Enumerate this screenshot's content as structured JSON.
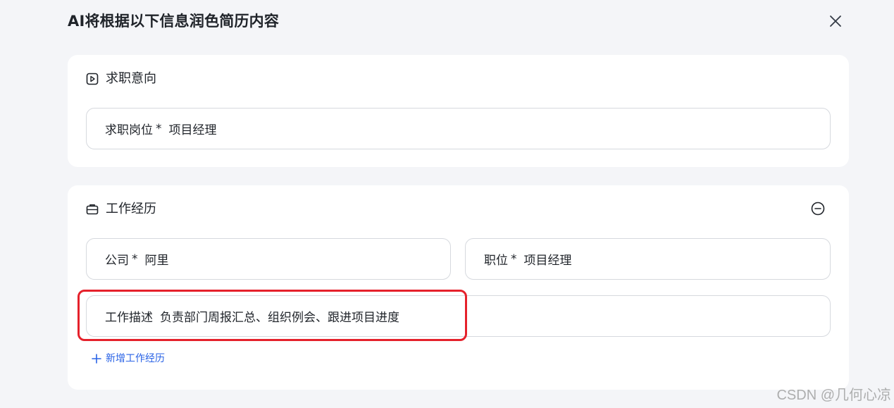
{
  "dialog": {
    "title": "AI将根据以下信息润色简历内容",
    "close_icon": "close-icon"
  },
  "job_intent": {
    "title": "求职意向",
    "icon": "flag-doc-icon",
    "position_label": "求职岗位",
    "required_mark": "*",
    "position_value": "项目经理"
  },
  "work_experience": {
    "title": "工作经历",
    "icon": "briefcase-icon",
    "collapse_icon": "minus-circle-icon",
    "company_label": "公司",
    "company_required": "*",
    "company_value": "阿里",
    "role_label": "职位",
    "role_required": "*",
    "role_value": "项目经理",
    "desc_label": "工作描述",
    "desc_value": "负责部门周报汇总、组织例会、跟进项目进度",
    "add_label": "新增工作经历",
    "add_icon": "plus-icon"
  },
  "highlight_color": "#e5212b",
  "accent_color": "#2a63e6",
  "watermark": "CSDN @几何心凉"
}
